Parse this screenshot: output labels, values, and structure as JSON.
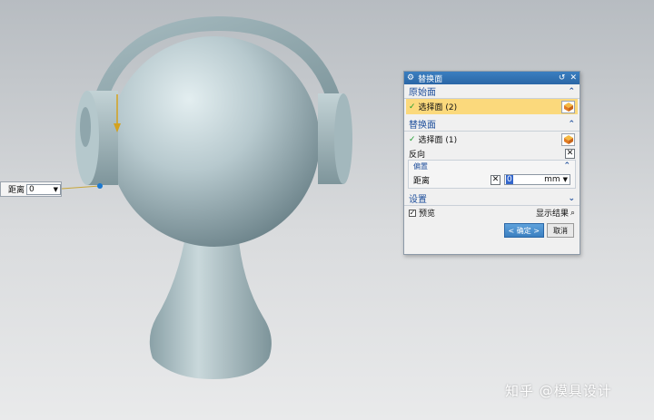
{
  "floating_input": {
    "label": "距离",
    "value": "0"
  },
  "dialog": {
    "title": "替换面",
    "section_original": {
      "title": "原始面",
      "select_label": "选择面 (2)"
    },
    "section_replace": {
      "title": "替换面",
      "select_label": "选择面 (1)",
      "reverse_label": "反向",
      "offset": {
        "title": "偏置",
        "distance_label": "距离",
        "distance_value": "0",
        "unit": "mm"
      }
    },
    "section_settings": {
      "title": "设置"
    },
    "preview_label": "预览",
    "show_result_label": "显示结果",
    "ok_label": "< 确定 >",
    "cancel_label": "取消"
  },
  "watermark": "知乎 @模具设计",
  "colors": {
    "model": "#a9bcc2",
    "title_bar": "#2a66a6",
    "highlight": "#fbd97c",
    "accent": "#1f4f9c"
  }
}
